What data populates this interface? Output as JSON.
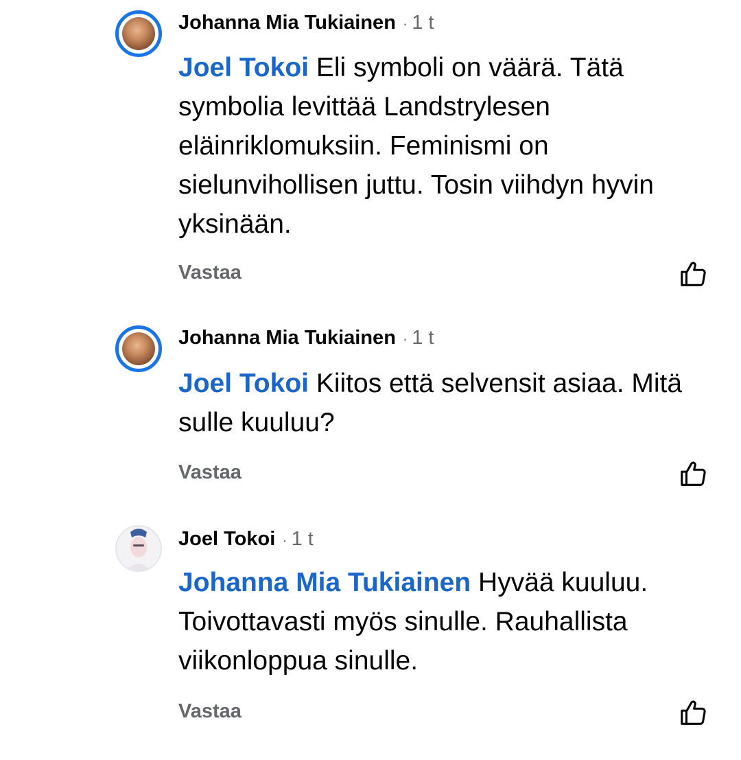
{
  "comments": [
    {
      "author": "Johanna Mia Tukiainen",
      "separator": "·",
      "time": "1 t",
      "mention": "Joel Tokoi",
      "text": "Eli symboli on väärä. Tätä symbolia levittää Landstrylesen eläinriklomuksiin. Feminismi on sielunvihollisen juttu. Tosin viihdyn hyvin yksinään.",
      "reply_label": "Vastaa",
      "like_icon": "thumbs-up-icon"
    },
    {
      "author": "Johanna Mia Tukiainen",
      "separator": "·",
      "time": "1 t",
      "mention": "Joel Tokoi",
      "text": "Kiitos että selvensit asiaa. Mitä sulle kuuluu?",
      "reply_label": "Vastaa",
      "like_icon": "thumbs-up-icon"
    },
    {
      "author": "Joel Tokoi",
      "separator": "·",
      "time": "1 t",
      "mention": "Johanna Mia Tukiainen",
      "text": " Hyvää kuuluu. Toivottavasti myös sinulle. Rauhallista viikonloppua sinulle.",
      "reply_label": "Vastaa",
      "like_icon": "thumbs-up-icon"
    }
  ],
  "colors": {
    "mention": "#1b66c9",
    "avatar_ring": "#1b74e4",
    "meta": "#65676b",
    "text": "#050505"
  }
}
